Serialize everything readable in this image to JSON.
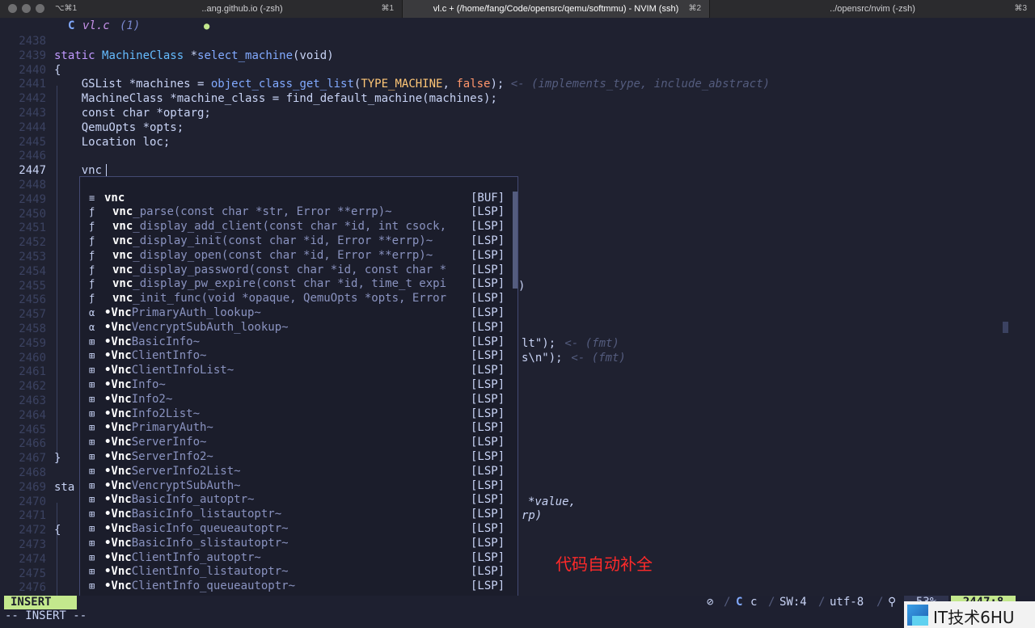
{
  "titlebar": {
    "tabs": [
      {
        "title": "",
        "shortcut": "⌥⌘1"
      },
      {
        "title": "..ang.github.io (-zsh)",
        "shortcut": "⌘1"
      },
      {
        "title": "vl.c + (/home/fang/Code/opensrc/qemu/softmmu) - NVIM (ssh)",
        "shortcut": "⌘2"
      },
      {
        "title": "../opensrc/nvim (-zsh)",
        "shortcut": "⌘3"
      }
    ]
  },
  "winbar": {
    "file_icon": "c-language-icon",
    "file_name": "vl.c",
    "diagnostic_count": "(1)",
    "modified_indicator": "●"
  },
  "editor": {
    "current_line": "2447",
    "lines": [
      {
        "n": "2438",
        "text": ""
      },
      {
        "n": "2439",
        "text": ""
      },
      {
        "n": "2440",
        "text": "{"
      },
      {
        "n": "2441",
        "text": ""
      },
      {
        "n": "2442",
        "text": "    MachineClass *machine_class = find_default_machine(machines);"
      },
      {
        "n": "2443",
        "text": "    const char *optarg;"
      },
      {
        "n": "2444",
        "text": "    QemuOpts *opts;"
      },
      {
        "n": "2445",
        "text": "    Location loc;"
      },
      {
        "n": "2446",
        "text": ""
      },
      {
        "n": "2447",
        "text": "    vnc"
      },
      {
        "n": "2448",
        "text": ""
      },
      {
        "n": "2449",
        "text": ""
      },
      {
        "n": "2450",
        "text": ""
      },
      {
        "n": "2451",
        "text": ""
      },
      {
        "n": "2452",
        "text": ""
      },
      {
        "n": "2453",
        "text": ""
      },
      {
        "n": "2454",
        "text": ""
      },
      {
        "n": "2455",
        "text": ""
      },
      {
        "n": "2456",
        "text": ""
      },
      {
        "n": "2457",
        "text": ""
      },
      {
        "n": "2458",
        "text": ""
      },
      {
        "n": "2459",
        "text": ""
      },
      {
        "n": "2460",
        "text": ""
      },
      {
        "n": "2461",
        "text": ""
      },
      {
        "n": "2462",
        "text": ""
      },
      {
        "n": "2463",
        "text": ""
      },
      {
        "n": "2464",
        "text": ""
      },
      {
        "n": "2465",
        "text": ""
      },
      {
        "n": "2466",
        "text": ""
      },
      {
        "n": "2467",
        "text": "}"
      },
      {
        "n": "2468",
        "text": ""
      },
      {
        "n": "2469",
        "text": "sta"
      },
      {
        "n": "2470",
        "text": ""
      },
      {
        "n": "2471",
        "text": ""
      },
      {
        "n": "2472",
        "text": "{"
      },
      {
        "n": "2473",
        "text": ""
      },
      {
        "n": "2474",
        "text": ""
      },
      {
        "n": "2475",
        "text": ""
      },
      {
        "n": "2476",
        "text": ""
      }
    ],
    "line_2439": {
      "kw": "static",
      "type": "MachineClass",
      "star": " *",
      "fn": "select_machine",
      "rest": "(void)"
    },
    "line_2441": {
      "pre": "    GSList *machines = ",
      "fn": "object_class_get_list",
      "open": "(",
      "macro": "TYPE_MACHINE",
      "comma": ", ",
      "bool": "false",
      "close": ");",
      "hint": " <- (implements_type, include_abstract)"
    },
    "line_2455_tail": ")",
    "line_2459_tail": {
      "code": "lt\");",
      "hint": " <- (fmt)"
    },
    "line_2460_tail": {
      "code": "s\\n\");",
      "hint": " <- (fmt)"
    },
    "line_2470_tail": "*value,",
    "line_2471_tail": "rp)"
  },
  "completion": {
    "items": [
      {
        "icon": "≡",
        "match": "vnc",
        "rest": "",
        "source": "[BUF]",
        "kind": "text"
      },
      {
        "icon": "ƒ",
        "match": "vnc",
        "rest": "_parse(const char *str, Error **errp)~",
        "source": "[LSP]",
        "kind": "function"
      },
      {
        "icon": "ƒ",
        "match": "vnc",
        "rest": "_display_add_client(const char *id, int csock,",
        "source": "[LSP]",
        "kind": "function"
      },
      {
        "icon": "ƒ",
        "match": "vnc",
        "rest": "_display_init(const char *id, Error **errp)~",
        "source": "[LSP]",
        "kind": "function"
      },
      {
        "icon": "ƒ",
        "match": "vnc",
        "rest": "_display_open(const char *id, Error **errp)~",
        "source": "[LSP]",
        "kind": "function"
      },
      {
        "icon": "ƒ",
        "match": "vnc",
        "rest": "_display_password(const char *id, const char *",
        "source": "[LSP]",
        "kind": "function"
      },
      {
        "icon": "ƒ",
        "match": "vnc",
        "rest": "_display_pw_expire(const char *id, time_t expi",
        "source": "[LSP]",
        "kind": "function"
      },
      {
        "icon": "ƒ",
        "match": "vnc",
        "rest": "_init_func(void *opaque, QemuOpts *opts, Error",
        "source": "[LSP]",
        "kind": "function"
      },
      {
        "icon": "α",
        "match": "•Vnc",
        "rest": "PrimaryAuth_lookup~",
        "source": "[LSP]",
        "kind": "variable"
      },
      {
        "icon": "α",
        "match": "•Vnc",
        "rest": "VencryptSubAuth_lookup~",
        "source": "[LSP]",
        "kind": "variable"
      },
      {
        "icon": "⊞",
        "match": "•Vnc",
        "rest": "BasicInfo~",
        "source": "[LSP]",
        "kind": "struct"
      },
      {
        "icon": "⊞",
        "match": "•Vnc",
        "rest": "ClientInfo~",
        "source": "[LSP]",
        "kind": "struct"
      },
      {
        "icon": "⊞",
        "match": "•Vnc",
        "rest": "ClientInfoList~",
        "source": "[LSP]",
        "kind": "struct"
      },
      {
        "icon": "⊞",
        "match": "•Vnc",
        "rest": "Info~",
        "source": "[LSP]",
        "kind": "struct"
      },
      {
        "icon": "⊞",
        "match": "•Vnc",
        "rest": "Info2~",
        "source": "[LSP]",
        "kind": "struct"
      },
      {
        "icon": "⊞",
        "match": "•Vnc",
        "rest": "Info2List~",
        "source": "[LSP]",
        "kind": "struct"
      },
      {
        "icon": "⊞",
        "match": "•Vnc",
        "rest": "PrimaryAuth~",
        "source": "[LSP]",
        "kind": "struct"
      },
      {
        "icon": "⊞",
        "match": "•Vnc",
        "rest": "ServerInfo~",
        "source": "[LSP]",
        "kind": "struct"
      },
      {
        "icon": "⊞",
        "match": "•Vnc",
        "rest": "ServerInfo2~",
        "source": "[LSP]",
        "kind": "struct"
      },
      {
        "icon": "⊞",
        "match": "•Vnc",
        "rest": "ServerInfo2List~",
        "source": "[LSP]",
        "kind": "struct"
      },
      {
        "icon": "⊞",
        "match": "•Vnc",
        "rest": "VencryptSubAuth~",
        "source": "[LSP]",
        "kind": "struct"
      },
      {
        "icon": "⊞",
        "match": "•Vnc",
        "rest": "BasicInfo_autoptr~",
        "source": "[LSP]",
        "kind": "struct"
      },
      {
        "icon": "⊞",
        "match": "•Vnc",
        "rest": "BasicInfo_listautoptr~",
        "source": "[LSP]",
        "kind": "struct"
      },
      {
        "icon": "⊞",
        "match": "•Vnc",
        "rest": "BasicInfo_queueautoptr~",
        "source": "[LSP]",
        "kind": "struct"
      },
      {
        "icon": "⊞",
        "match": "•Vnc",
        "rest": "BasicInfo_slistautoptr~",
        "source": "[LSP]",
        "kind": "struct"
      },
      {
        "icon": "⊞",
        "match": "•Vnc",
        "rest": "ClientInfo_autoptr~",
        "source": "[LSP]",
        "kind": "struct"
      },
      {
        "icon": "⊞",
        "match": "•Vnc",
        "rest": "ClientInfo_listautoptr~",
        "source": "[LSP]",
        "kind": "struct"
      },
      {
        "icon": "⊞",
        "match": "•Vnc",
        "rest": "ClientInfo_queueautoptr~",
        "source": "[LSP]",
        "kind": "struct"
      }
    ]
  },
  "overlay_caption": "代码自动补全",
  "statusline": {
    "mode": "INSERT",
    "lsp_icon": "⊘",
    "filetype_icon": "c-language-icon",
    "filetype": "c",
    "shiftwidth": "SW:4",
    "encoding": "utf-8",
    "os_icon": "linux-penguin-icon",
    "percent": "53%",
    "position": "2447:8"
  },
  "cmdline": "-- INSERT --",
  "watermark": {
    "text": "IT技术6HU"
  }
}
